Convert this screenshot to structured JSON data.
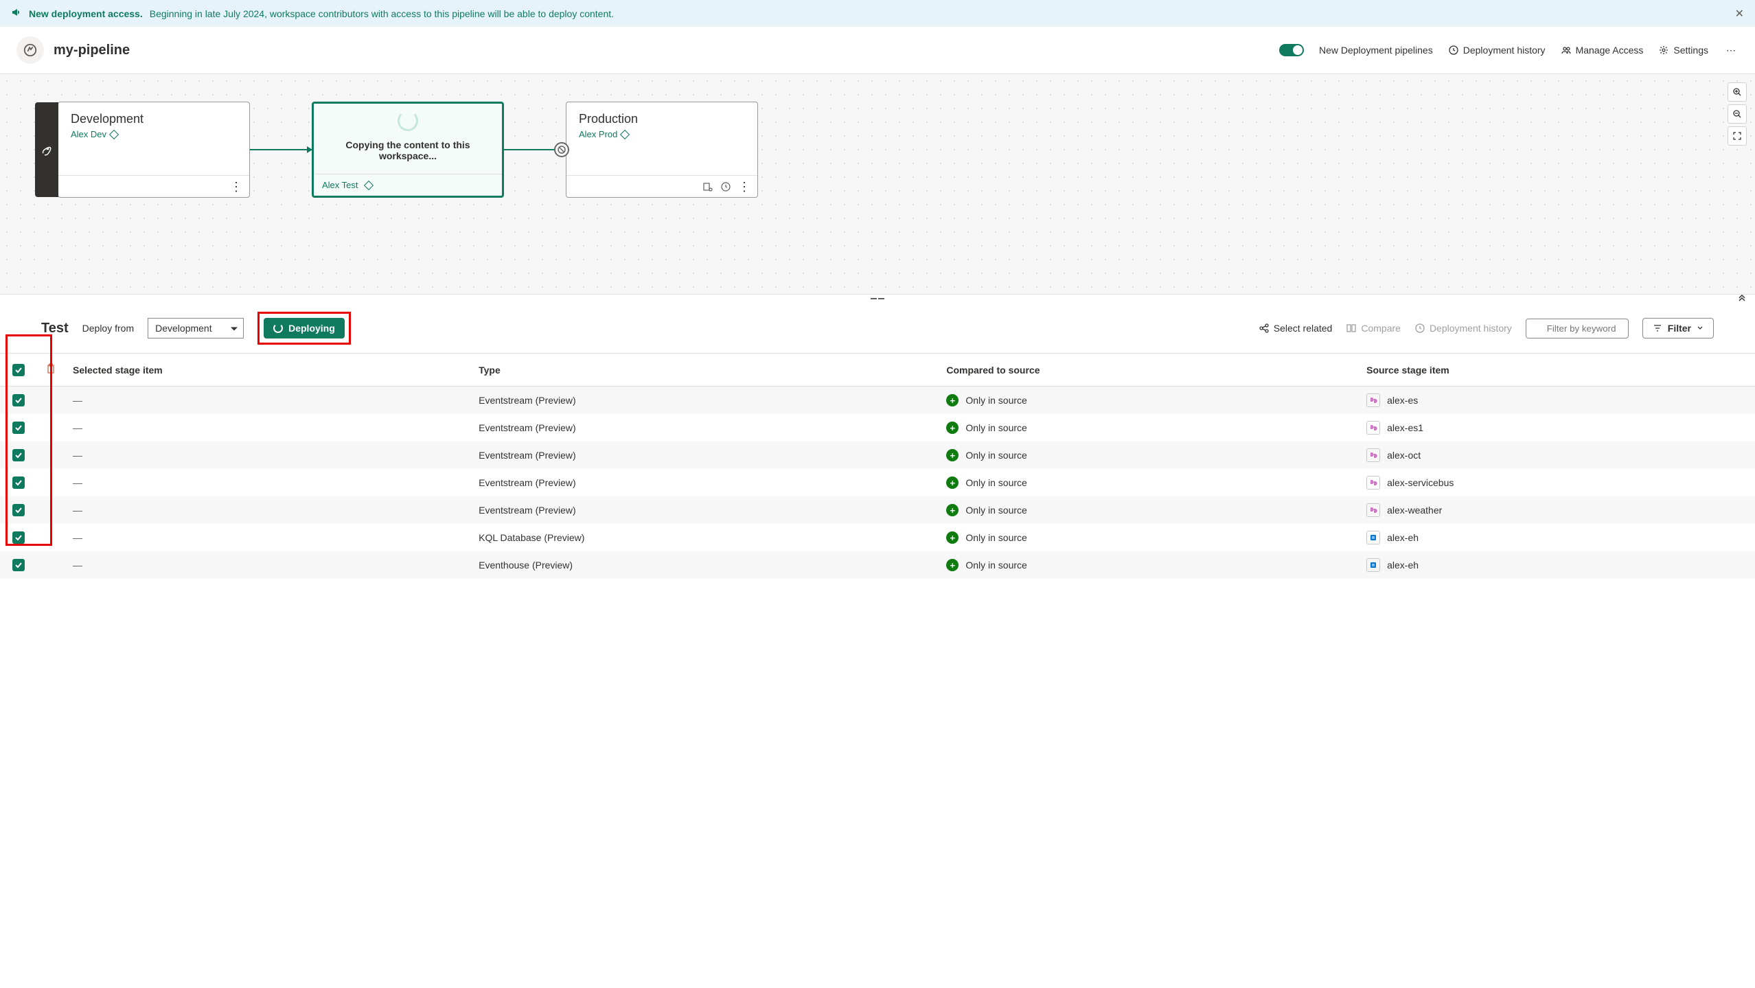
{
  "notification": {
    "title": "New deployment access.",
    "text": "Beginning in late July 2024, workspace contributors with access to this pipeline will be able to deploy content."
  },
  "header": {
    "title": "my-pipeline",
    "toggle_label": "New Deployment pipelines",
    "history_label": "Deployment history",
    "access_label": "Manage Access",
    "settings_label": "Settings"
  },
  "stages": {
    "dev": {
      "name": "Development",
      "workspace": "Alex Dev"
    },
    "test": {
      "copying": "Copying the content to this workspace...",
      "workspace": "Alex Test"
    },
    "prod": {
      "name": "Production",
      "workspace": "Alex Prod"
    }
  },
  "detail": {
    "title": "Test",
    "deploy_from_label": "Deploy from",
    "deploy_from_value": "Development",
    "deploying_label": "Deploying",
    "select_related": "Select related",
    "compare": "Compare",
    "deployment_history": "Deployment history",
    "filter_placeholder": "Filter by keyword",
    "filter_label": "Filter"
  },
  "table": {
    "headers": {
      "stage_item": "Selected stage item",
      "type": "Type",
      "compared": "Compared to source",
      "source_item": "Source stage item"
    },
    "only_in_source": "Only in source",
    "rows": [
      {
        "type": "Eventstream (Preview)",
        "source": "alex-es",
        "icon": "es"
      },
      {
        "type": "Eventstream (Preview)",
        "source": "alex-es1",
        "icon": "es"
      },
      {
        "type": "Eventstream (Preview)",
        "source": "alex-oct",
        "icon": "es"
      },
      {
        "type": "Eventstream (Preview)",
        "source": "alex-servicebus",
        "icon": "es"
      },
      {
        "type": "Eventstream (Preview)",
        "source": "alex-weather",
        "icon": "es"
      },
      {
        "type": "KQL Database (Preview)",
        "source": "alex-eh",
        "icon": "kql"
      },
      {
        "type": "Eventhouse (Preview)",
        "source": "alex-eh",
        "icon": "kql"
      }
    ]
  }
}
